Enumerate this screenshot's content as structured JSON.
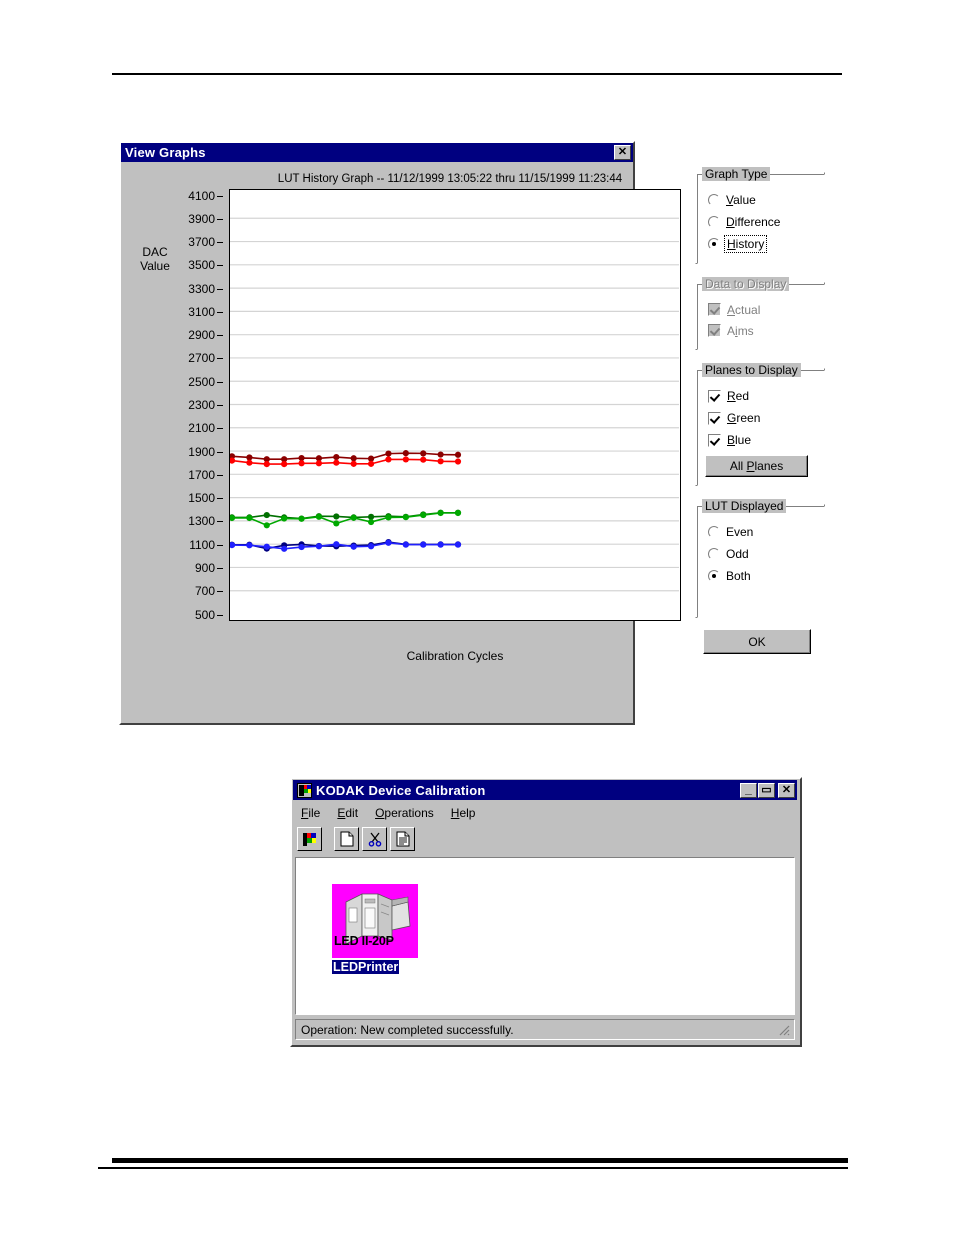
{
  "view_graphs": {
    "title": "View Graphs",
    "close_label": "✕",
    "graph_title": "LUT History Graph -- 11/12/1999 13:05:22   thru   11/15/1999 11:23:44",
    "y_axis_title_line1": "DAC",
    "y_axis_title_line2": "Value",
    "x_axis_label": "Calibration Cycles",
    "groups": {
      "graph_type": {
        "legend": "Graph Type",
        "options": [
          {
            "label": "Value",
            "mnemonic": "V",
            "selected": false
          },
          {
            "label": "Difference",
            "mnemonic": "D",
            "selected": false
          },
          {
            "label": "History",
            "mnemonic": "H",
            "selected": true,
            "focused": true
          }
        ]
      },
      "data_to_display": {
        "legend": "Data to Display",
        "disabled": true,
        "options": [
          {
            "label": "Actual",
            "mnemonic": "A",
            "checked": true,
            "disabled": true
          },
          {
            "label": "Aims",
            "mnemonic": "i",
            "checked": true,
            "disabled": true
          }
        ]
      },
      "planes_to_display": {
        "legend": "Planes to Display",
        "options": [
          {
            "label": "Red",
            "mnemonic": "R",
            "checked": true
          },
          {
            "label": "Green",
            "mnemonic": "G",
            "checked": true
          },
          {
            "label": "Blue",
            "mnemonic": "B",
            "checked": true
          }
        ],
        "all_planes_button": "All Planes"
      },
      "lut_displayed": {
        "legend": "LUT Displayed",
        "options": [
          {
            "label": "Even",
            "selected": false
          },
          {
            "label": "Odd",
            "selected": false
          },
          {
            "label": "Both",
            "selected": true
          }
        ]
      }
    },
    "ok_button": "OK"
  },
  "chart_data": {
    "type": "line",
    "title": "LUT History Graph -- 11/12/1999 13:05:22   thru   11/15/1999 11:23:44",
    "xlabel": "Calibration Cycles",
    "ylabel": "DAC Value",
    "ylim": [
      500,
      4100
    ],
    "ytick_step": 200,
    "ytick_labels": [
      4100,
      3900,
      3700,
      3500,
      3300,
      3100,
      2900,
      2700,
      2500,
      2300,
      2100,
      1900,
      1700,
      1500,
      1300,
      1100,
      900,
      700,
      500
    ],
    "grid": true,
    "legend": "none",
    "x": [
      0,
      1,
      2,
      3,
      4,
      5,
      6,
      7,
      8,
      9,
      10,
      11,
      12,
      13
    ],
    "series": [
      {
        "name": "Red (even)",
        "color": "#8b0000",
        "values": [
          1855,
          1845,
          1830,
          1830,
          1840,
          1838,
          1848,
          1838,
          1835,
          1878,
          1882,
          1880,
          1870,
          1868
        ]
      },
      {
        "name": "Red (odd)",
        "color": "#ff0000",
        "values": [
          1818,
          1800,
          1788,
          1788,
          1795,
          1795,
          1800,
          1790,
          1790,
          1828,
          1828,
          1826,
          1812,
          1810
        ]
      },
      {
        "name": "Green (even)",
        "color": "#007000",
        "values": [
          1330,
          1330,
          1350,
          1330,
          1320,
          1340,
          1338,
          1330,
          1335,
          1340,
          1335,
          1355,
          1370,
          1370
        ]
      },
      {
        "name": "Green (odd)",
        "color": "#00a800",
        "values": [
          1325,
          1325,
          1262,
          1320,
          1318,
          1335,
          1278,
          1326,
          1290,
          1330,
          1332,
          1350,
          1368,
          1368
        ]
      },
      {
        "name": "Blue (even)",
        "color": "#000080",
        "values": [
          1095,
          1095,
          1062,
          1090,
          1098,
          1085,
          1082,
          1088,
          1092,
          1118,
          1098,
          1098,
          1098,
          1098
        ]
      },
      {
        "name": "Blue (odd)",
        "color": "#2020ff",
        "values": [
          1092,
          1090,
          1078,
          1060,
          1075,
          1082,
          1100,
          1078,
          1082,
          1112,
          1096,
          1096,
          1096,
          1096
        ]
      }
    ]
  },
  "kodak": {
    "title": "KODAK Device Calibration",
    "window_buttons": {
      "minimize": "_",
      "maximize": "▭",
      "close": "✕"
    },
    "menu": [
      {
        "label": "File",
        "mnemonic": "F"
      },
      {
        "label": "Edit",
        "mnemonic": "E"
      },
      {
        "label": "Operations",
        "mnemonic": "O"
      },
      {
        "label": "Help",
        "mnemonic": "H"
      }
    ],
    "toolbar": [
      {
        "name": "calibration-icon"
      },
      {
        "name": "new-document-icon"
      },
      {
        "name": "cut-scissors-icon"
      },
      {
        "name": "paste-document-icon"
      }
    ],
    "device": {
      "caption": "LED II-20P",
      "label": "LEDPrinter"
    },
    "statusbar": "Operation: New  completed successfully."
  }
}
